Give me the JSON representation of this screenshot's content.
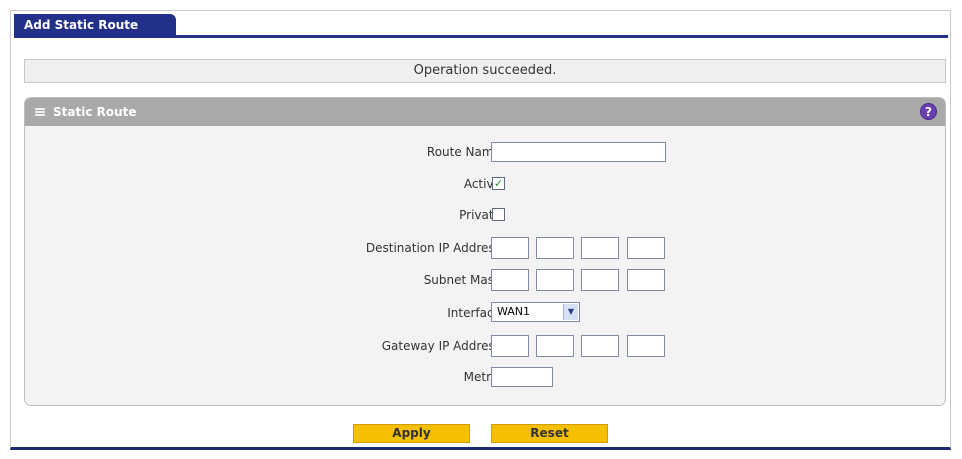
{
  "tab": {
    "label": "Add Static Route"
  },
  "status": {
    "message": "Operation succeeded."
  },
  "panel": {
    "title": "Static Route",
    "help_glyph": "?",
    "fields": {
      "route_name": {
        "label": "Route Name:",
        "value": ""
      },
      "active": {
        "label": "Active:",
        "checked": true,
        "mark": "✓"
      },
      "private": {
        "label": "Private:",
        "checked": false
      },
      "destination_ip": {
        "label": "Destination IP Address:",
        "octets": [
          "",
          "",
          "",
          ""
        ]
      },
      "subnet_mask": {
        "label": "Subnet Mask:",
        "octets": [
          "",
          "",
          "",
          ""
        ]
      },
      "interface": {
        "label": "Interface:",
        "selected": "WAN1",
        "arrow": "▼"
      },
      "gateway_ip": {
        "label": "Gateway IP Address:",
        "octets": [
          "",
          "",
          "",
          ""
        ]
      },
      "metric": {
        "label": "Metric:",
        "value": ""
      }
    }
  },
  "buttons": {
    "apply": "Apply",
    "reset": "Reset"
  },
  "colors": {
    "tab_bg": "#23308a",
    "header_bg": "#a9a9a9",
    "button_bg": "#f5c000",
    "help_icon": "#6a3fb3",
    "check": "#2a8a2a"
  },
  "icons": {
    "help": "help-icon",
    "grip": "grip-icon",
    "dropdown": "chevron-down-icon"
  }
}
